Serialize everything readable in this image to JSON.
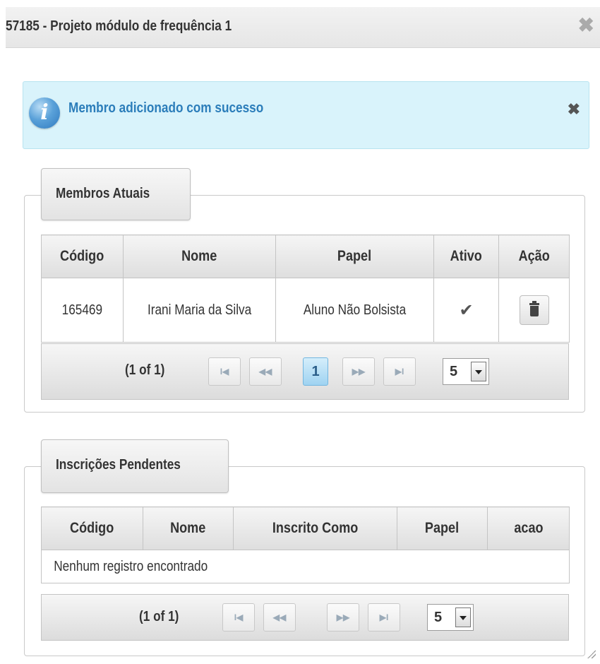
{
  "dialog": {
    "title": "57185 - Projeto módulo de frequência 1",
    "close_glyph": "✖"
  },
  "message": {
    "text": "Membro adicionado com sucesso",
    "close_glyph": "✖",
    "icon": "info-icon",
    "icon_glyph": "i"
  },
  "members": {
    "legend": "Membros Atuais",
    "columns": [
      "Código",
      "Nome",
      "Papel",
      "Ativo",
      "Ação"
    ],
    "rows": [
      {
        "codigo": "165469",
        "nome": "Irani Maria da Silva",
        "papel": "Aluno Não Bolsista",
        "ativo": "✔",
        "acao_icon": "trash-icon"
      }
    ],
    "paginator": {
      "count": "(1 of 1)",
      "first": "I◀",
      "prev": "◀◀",
      "current_page": "1",
      "next": "▶▶",
      "last": "▶I",
      "rows_per_page": "5"
    }
  },
  "pending": {
    "legend": "Inscrições Pendentes",
    "columns": [
      "Código",
      "Nome",
      "Inscrito Como",
      "Papel",
      "acao"
    ],
    "empty_message": "Nenhum registro encontrado",
    "paginator": {
      "count": "(1 of 1)",
      "first": "I◀",
      "prev": "◀◀",
      "next": "▶▶",
      "last": "▶I",
      "rows_per_page": "5"
    }
  },
  "colors": {
    "info_background": "#d9f3fb",
    "info_text": "#2b7dba",
    "active_page": "#9fd3f1"
  }
}
